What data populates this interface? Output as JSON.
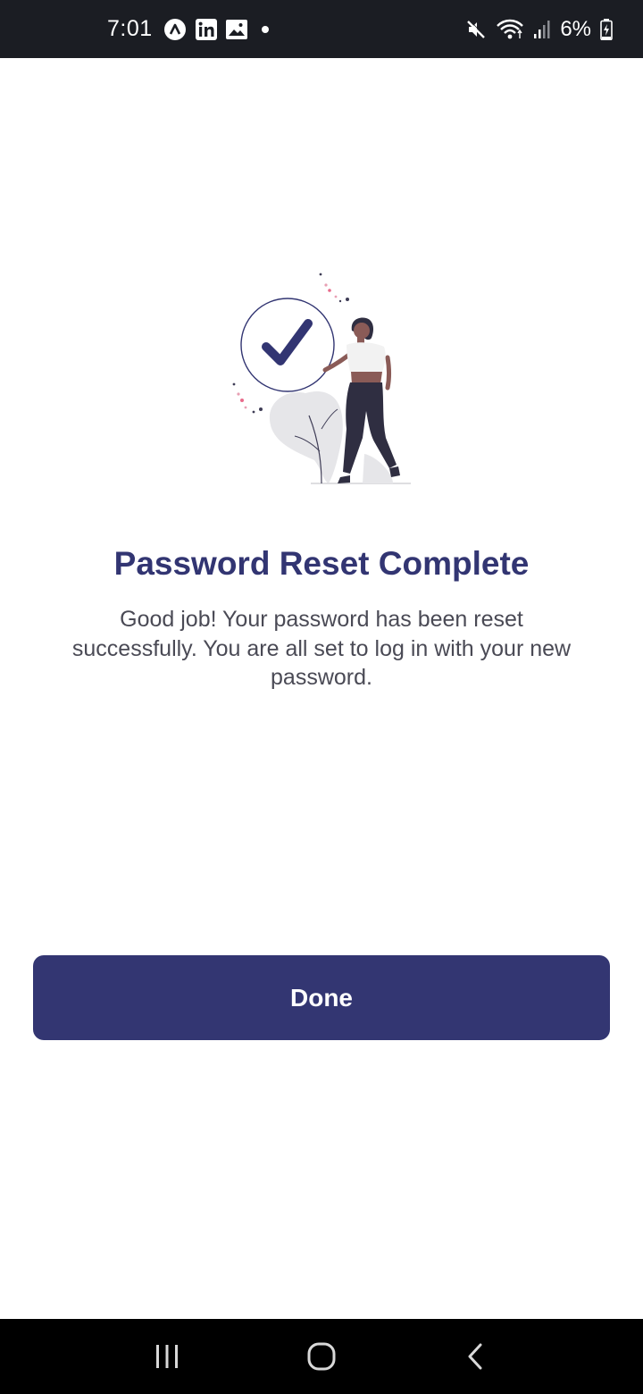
{
  "status_bar": {
    "time": "7:01",
    "battery": "6%",
    "notification_icons": [
      "app-a-icon",
      "linkedin-icon",
      "image-icon"
    ],
    "system_icons": [
      "mute-icon",
      "wifi-icon",
      "signal-icon",
      "battery-charging-icon"
    ]
  },
  "illustration": {
    "name": "success-checkmark-illustration",
    "accent_color": "#323572"
  },
  "content": {
    "title": "Password Reset Complete",
    "message": "Good job! Your password has been reset successfully. You are all set to log in with your new password."
  },
  "actions": {
    "done_label": "Done",
    "button_color": "#333672"
  },
  "nav_bar": {
    "buttons": [
      "recent-apps-icon",
      "home-icon",
      "back-icon"
    ]
  }
}
